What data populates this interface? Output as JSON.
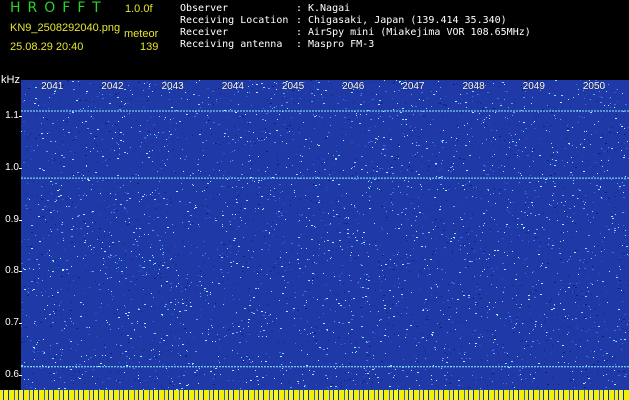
{
  "app": {
    "name": "HROFFT",
    "version": "1.0.0f"
  },
  "file": {
    "name": "KN9_2508292040.png",
    "mode": "meteor",
    "timestamp": "25.08.29 20:40",
    "count": "139"
  },
  "info": [
    {
      "key": "Observer",
      "value": "K.Nagai"
    },
    {
      "key": "Receiving Location",
      "value": "Chigasaki, Japan (139.414 35.340)"
    },
    {
      "key": "Receiver",
      "value": "AirSpy mini (Miakejima VOR 108.65MHz)"
    },
    {
      "key": "Receiving antenna",
      "value": "Maspro FM-3"
    }
  ],
  "colors": {
    "background": "#000000",
    "plot": "#1f3aa6",
    "title": "#2bd22b",
    "meta": "#e6e62a"
  },
  "chart_data": {
    "type": "heatmap",
    "ylabel": "kHz",
    "y_ticks": [
      "1.1",
      "1.0",
      "0.9",
      "0.8",
      "0.7",
      "0.6"
    ],
    "x_ticks": [
      "2041",
      "2042",
      "2043",
      "2044",
      "2045",
      "2046",
      "2047",
      "2048",
      "2049",
      "2050"
    ],
    "ylim": [
      0.57,
      1.17
    ],
    "xlim": [
      2040.5,
      2050.6
    ],
    "horizontal_lines_khz": [
      1.11,
      0.98,
      0.615
    ],
    "grid": false
  }
}
